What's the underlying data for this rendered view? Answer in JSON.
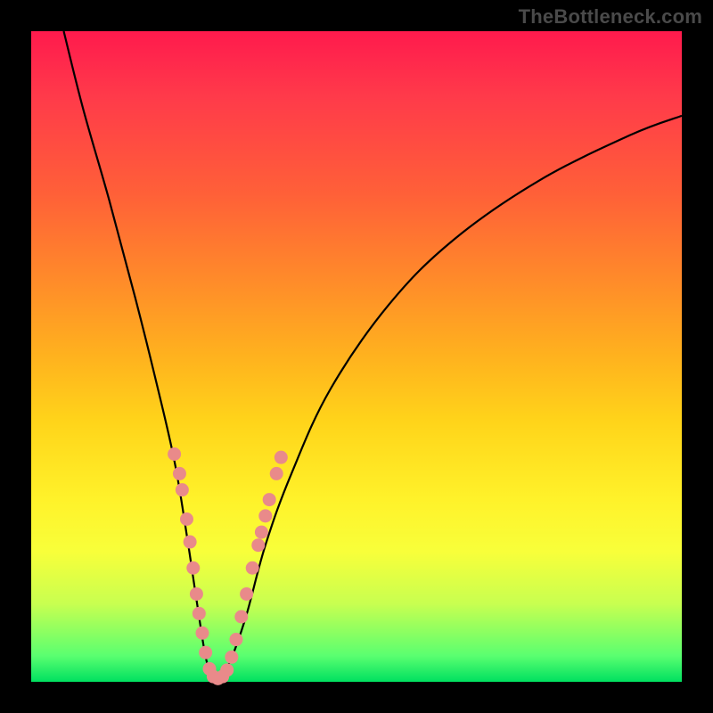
{
  "watermark": "TheBottleneck.com",
  "chart_data": {
    "type": "line",
    "title": "",
    "xlabel": "",
    "ylabel": "",
    "xlim": [
      0,
      100
    ],
    "ylim": [
      0,
      100
    ],
    "series": [
      {
        "name": "bottleneck-curve",
        "x": [
          5,
          8,
          12,
          16,
          19,
          22,
          24,
          25.5,
          27,
          28.5,
          30.5,
          33,
          36,
          40,
          46,
          55,
          65,
          78,
          92,
          100
        ],
        "y": [
          100,
          88,
          74,
          59,
          47,
          34,
          22,
          12,
          3,
          0,
          3,
          10,
          21,
          32,
          45,
          58,
          68,
          77,
          84,
          87
        ]
      }
    ],
    "markers": {
      "name": "highlight-dots",
      "points": [
        {
          "x": 22.0,
          "y": 35.0
        },
        {
          "x": 22.8,
          "y": 32.0
        },
        {
          "x": 23.2,
          "y": 29.5
        },
        {
          "x": 23.9,
          "y": 25.0
        },
        {
          "x": 24.4,
          "y": 21.5
        },
        {
          "x": 24.9,
          "y": 17.5
        },
        {
          "x": 25.4,
          "y": 13.5
        },
        {
          "x": 25.8,
          "y": 10.5
        },
        {
          "x": 26.3,
          "y": 7.5
        },
        {
          "x": 26.8,
          "y": 4.5
        },
        {
          "x": 27.4,
          "y": 2.0
        },
        {
          "x": 28.0,
          "y": 0.8
        },
        {
          "x": 28.7,
          "y": 0.5
        },
        {
          "x": 29.4,
          "y": 0.8
        },
        {
          "x": 30.1,
          "y": 1.8
        },
        {
          "x": 30.8,
          "y": 3.8
        },
        {
          "x": 31.5,
          "y": 6.5
        },
        {
          "x": 32.3,
          "y": 10.0
        },
        {
          "x": 33.1,
          "y": 13.5
        },
        {
          "x": 34.0,
          "y": 17.5
        },
        {
          "x": 34.9,
          "y": 21.0
        },
        {
          "x": 35.4,
          "y": 23.0
        },
        {
          "x": 36.0,
          "y": 25.5
        },
        {
          "x": 36.6,
          "y": 28.0
        },
        {
          "x": 37.7,
          "y": 32.0
        },
        {
          "x": 38.4,
          "y": 34.5
        }
      ]
    },
    "gradient_stops": [
      {
        "pos": 0.0,
        "color": "#ff1a4d"
      },
      {
        "pos": 0.5,
        "color": "#ffd41a"
      },
      {
        "pos": 1.0,
        "color": "#00e060"
      }
    ]
  }
}
